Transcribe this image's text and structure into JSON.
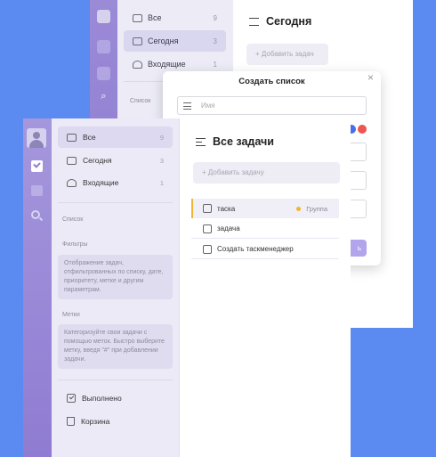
{
  "back_window": {
    "sidebar_items": [
      {
        "label": "Все",
        "count": "9"
      },
      {
        "label": "Сегодня",
        "count": "3"
      },
      {
        "label": "Входящие",
        "count": "1"
      }
    ],
    "section_label": "Список",
    "title": "Сегодня",
    "add_task_placeholder": "+ Добавить задач"
  },
  "modal": {
    "title": "Создать список",
    "close_symbol": "×",
    "name_placeholder": "Имя",
    "save_label": "ь",
    "colors": {
      "blue": "#4a6ee8",
      "red": "#ee5555"
    }
  },
  "front_window": {
    "sidebar": {
      "items": [
        {
          "label": "Все",
          "count": "9"
        },
        {
          "label": "Сегодня",
          "count": "3"
        },
        {
          "label": "Входящие",
          "count": "1"
        }
      ],
      "list_section": "Список",
      "filters_section": "Фильтры",
      "filters_hint": "Отображение задач, отфильтрованных по списку, дате, приоритету, метке и другим параметрам.",
      "tags_section": "Метки",
      "tags_hint": "Категоризуйте свои задачи с помощью меток. Быстро выберите метку, введя \"#\" при добавлении задачи.",
      "done_label": "Выполнено",
      "trash_label": "Корзина"
    },
    "main": {
      "title": "Все задачи",
      "add_task_placeholder": "+ Добавить задачу",
      "tasks": [
        {
          "label": "таска",
          "tag": "Группа"
        },
        {
          "label": "задача"
        },
        {
          "label": "Создать таскменеджер"
        }
      ]
    }
  },
  "colors": {
    "background": "#5b8af0",
    "accent": "#8f7cd2",
    "task_marker": "#f2b531"
  }
}
